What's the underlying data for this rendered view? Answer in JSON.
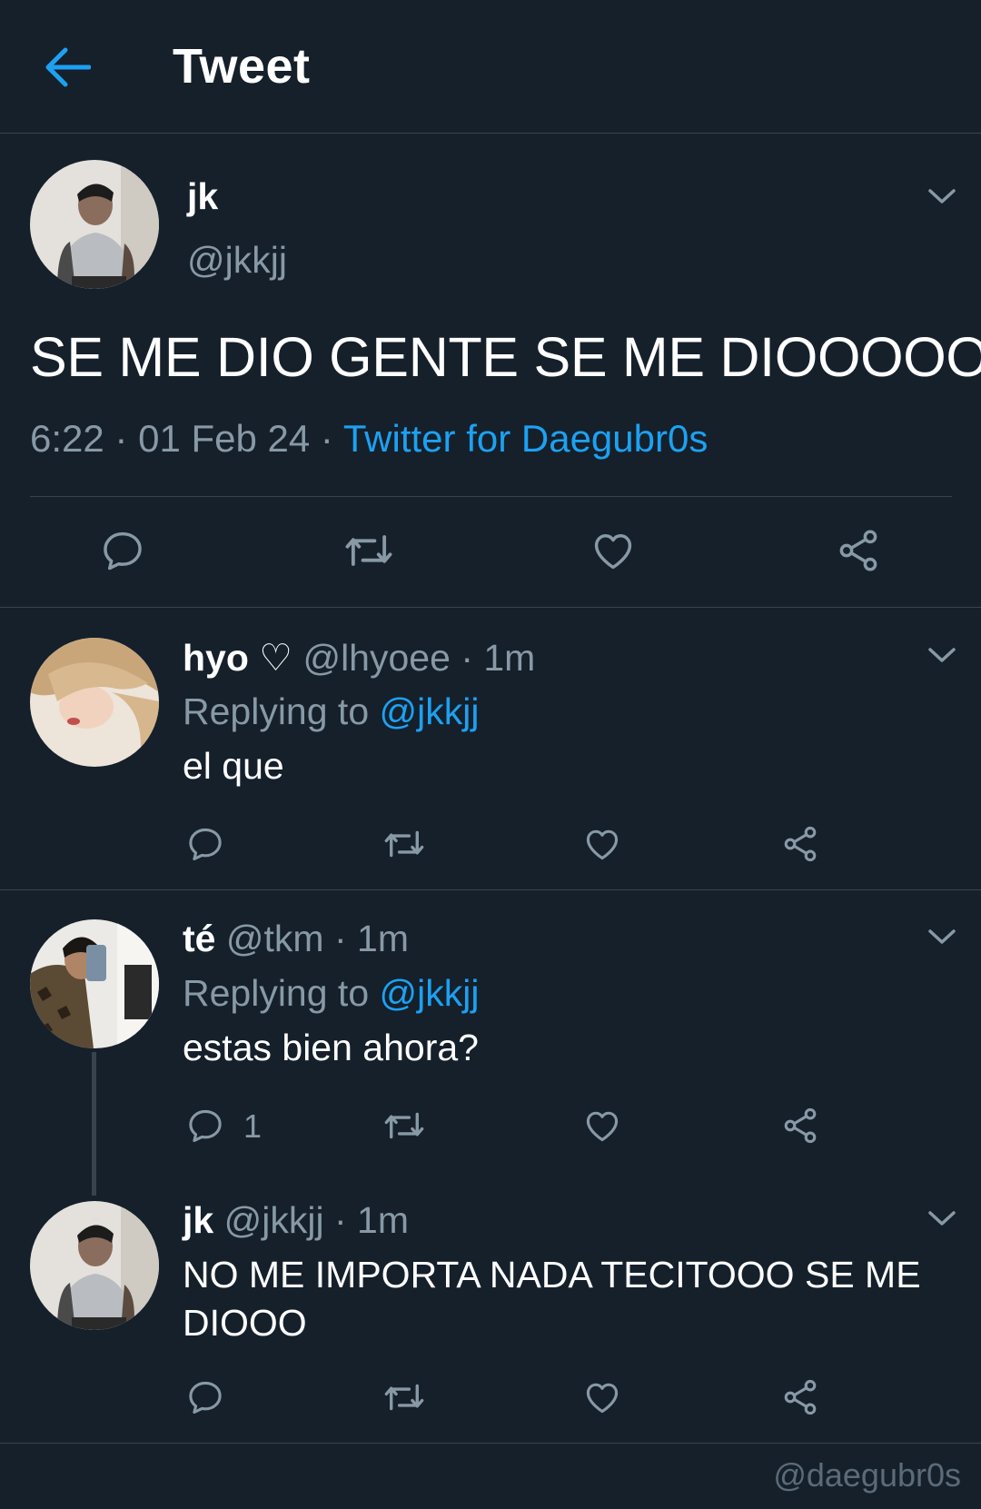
{
  "header": {
    "title": "Tweet",
    "back_icon": "arrow-left-icon"
  },
  "colors": {
    "background": "#15202b",
    "accent": "#1da1f2",
    "muted": "#8899a6",
    "divider": "#38444d"
  },
  "main_tweet": {
    "name": "jk",
    "handle": "@jkkjj",
    "text": "SE ME DIO GENTE SE ME DIOOOOO",
    "time": "6:22",
    "date": "01 Feb 24",
    "source": "Twitter for Daegubr0s"
  },
  "replies": [
    {
      "name": "hyo ♡",
      "handle": "@lhyoee",
      "time": "1m",
      "replying_label": "Replying to",
      "replying_to": "@jkkjj",
      "text": "el que"
    },
    {
      "name": "té",
      "handle": "@tkm",
      "time": "1m",
      "replying_label": "Replying to",
      "replying_to": "@jkkjj",
      "text": "estas bien ahora?",
      "reply_count": "1"
    },
    {
      "name": "jk",
      "handle": "@jkkjj",
      "time": "1m",
      "text_line1": "NO ME IMPORTA NADA TECITOOO SE ME",
      "text_line2": "DIOOO"
    }
  ],
  "separator": "·",
  "watermark": "@daegubr0s"
}
